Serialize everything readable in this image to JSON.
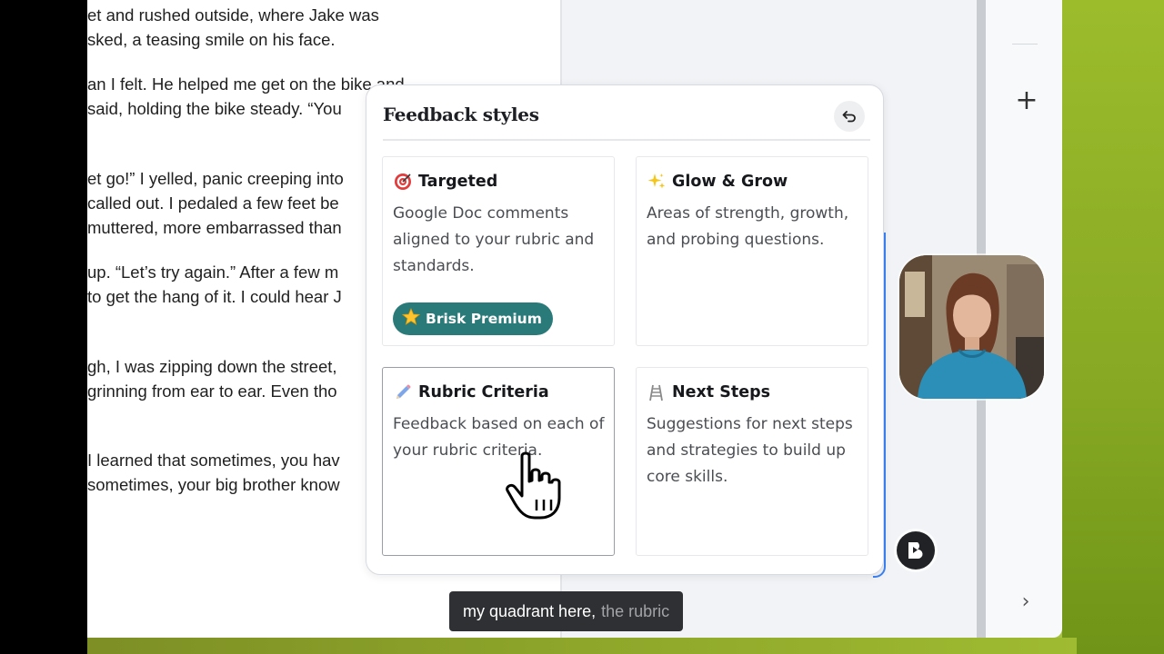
{
  "document": {
    "lines": [
      "et and rushed outside, where Jake was",
      "sked, a teasing smile on his face.",
      "an I felt. He helped me get on the bike and",
      "said, holding the bike steady. “You",
      "et go!” I yelled, panic creeping into",
      "called out. I pedaled a few feet be",
      "muttered, more embarrassed than",
      "up. “Let’s try again.” After a few m",
      "to get the hang of it. I could hear J",
      "gh, I was zipping down the street,",
      "grinning from ear to ear. Even tho",
      "I learned that sometimes, you hav",
      "sometimes, your big brother know"
    ]
  },
  "panel": {
    "title": "Feedback styles",
    "undo_icon": "undo-icon",
    "options": [
      {
        "title": "Targeted",
        "icon": "target-icon",
        "description": "Google Doc comments aligned to your rubric and standards.",
        "badge": "Brisk Premium",
        "badge_icon": "star-icon"
      },
      {
        "title": "Glow & Grow",
        "icon": "sparkles-icon",
        "description": "Areas of strength, growth, and probing questions."
      },
      {
        "title": "Rubric Criteria",
        "icon": "pencil-icon",
        "description": "Feedback based on each of your rubric criteria."
      },
      {
        "title": "Next Steps",
        "icon": "ladder-icon",
        "description": "Suggestions for next steps and strategies to build up core skills."
      }
    ]
  },
  "sidebar": {
    "add_icon": "plus-icon",
    "next_icon": "chevron-right-icon"
  },
  "caption": {
    "spoken": "my quadrant here,",
    "upcoming": "the rubric"
  },
  "colors": {
    "premium_badge": "#2b7a7a",
    "accent_blue": "#3b82f6",
    "background_green": "#9fb63c"
  }
}
